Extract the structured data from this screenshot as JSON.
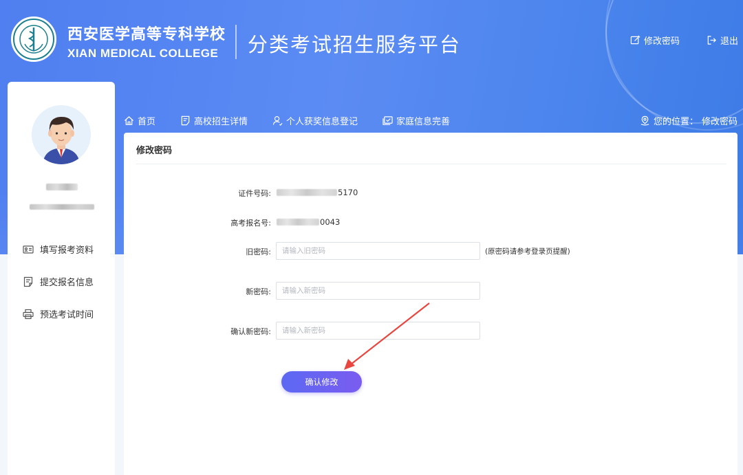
{
  "header": {
    "school_cn": "西安医学高等专科学校",
    "school_en": "XIAN MEDICAL COLLEGE",
    "platform_title": "分类考试招生服务平台",
    "links": [
      {
        "label": "修改密码",
        "icon": "edit-icon"
      },
      {
        "label": "退出",
        "icon": "logout-icon"
      }
    ]
  },
  "sidebar": {
    "items": [
      {
        "label": "填写报考资料",
        "icon": "id-card-icon"
      },
      {
        "label": "提交报名信息",
        "icon": "document-icon"
      },
      {
        "label": "预选考试时间",
        "icon": "printer-icon"
      }
    ]
  },
  "nav": {
    "items": [
      {
        "label": "首页",
        "icon": "home-icon"
      },
      {
        "label": "高校招生详情",
        "icon": "notebook-icon"
      },
      {
        "label": "个人获奖信息登记",
        "icon": "user-icon"
      },
      {
        "label": "家庭信息完善",
        "icon": "checklist-icon"
      }
    ],
    "location_label": "您的位置：",
    "location_value": "修改密码"
  },
  "panel": {
    "title": "修改密码",
    "form": {
      "id_label": "证件号码:",
      "id_suffix": "5170",
      "exam_no_label": "高考报名号:",
      "exam_no_suffix": "0043",
      "old_pwd_label": "旧密码:",
      "old_pwd_placeholder": "请输入旧密码",
      "old_pwd_hint": "(原密码请参考登录页提醒)",
      "new_pwd_label": "新密码:",
      "new_pwd_placeholder": "请输入新密码",
      "confirm_pwd_label": "确认新密码:",
      "confirm_pwd_placeholder": "请输入新密码",
      "submit_label": "确认修改"
    }
  },
  "colors": {
    "header_blue": "#4f7ff0",
    "button_start": "#5c69f2",
    "button_end": "#7a5cf0",
    "arrow_red": "#e8463e"
  }
}
